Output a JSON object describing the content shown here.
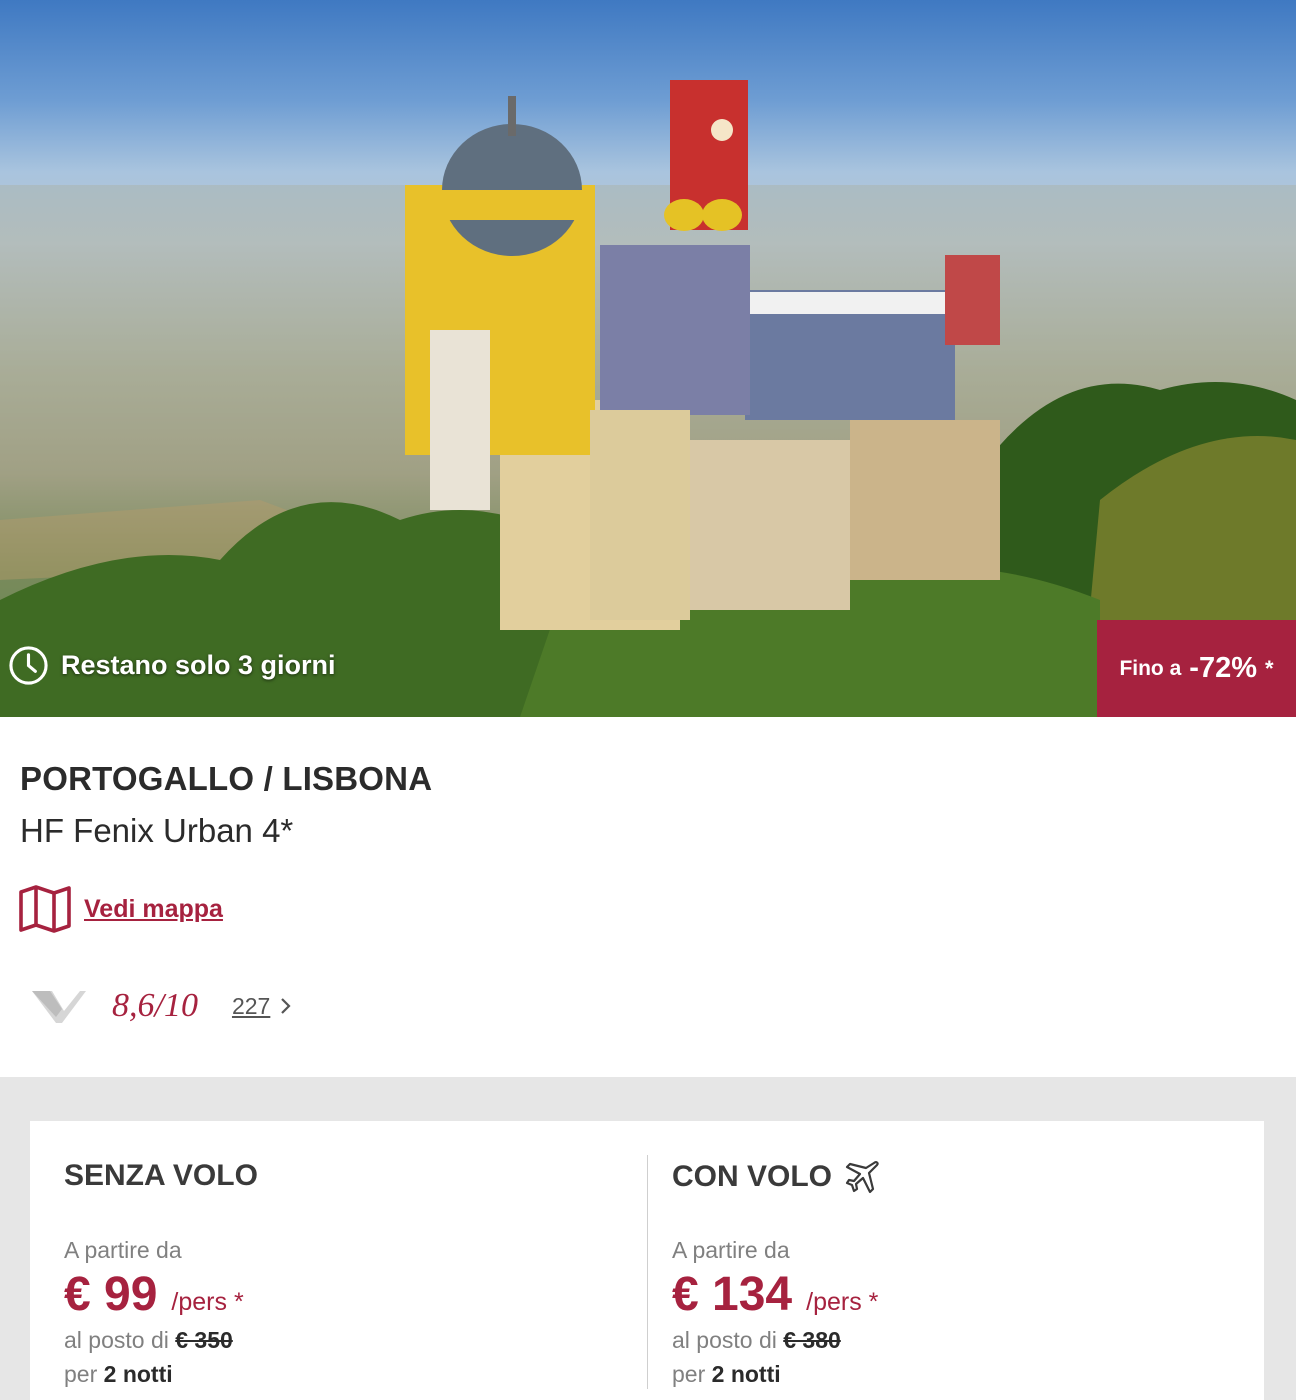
{
  "hero": {
    "image": "Pena Palace castle on a forested hill",
    "timer_icon": "clock-icon",
    "timer_text": "Restano solo 3 giorni",
    "discount": {
      "prefix": "Fino a",
      "value": "-72%",
      "asterisk": "*"
    }
  },
  "offer": {
    "location": "PORTOGALLO / LISBONA",
    "hotel": "HF Fenix Urban 4*",
    "map_icon": "map-icon",
    "map_link": "Vedi mappa",
    "rating": {
      "logo_icon": "voyage-privé-logo-icon",
      "score": "8,6/10",
      "reviews": "227",
      "chevron_icon": "chevron-right-icon"
    }
  },
  "pricing": {
    "without_flight": {
      "title": "SENZA VOLO",
      "from_label": "A partire da",
      "price": "€ 99",
      "per": "/pers *",
      "instead_label": "al posto di",
      "old_price": "€ 350",
      "per_label": "per",
      "nights": "2 notti"
    },
    "with_flight": {
      "title": "CON VOLO",
      "title_icon": "airplane-icon",
      "from_label": "A partire da",
      "price": "€ 134",
      "per": "/pers *",
      "instead_label": "al posto di",
      "old_price": "€ 380",
      "per_label": "per",
      "nights": "2 notti"
    }
  },
  "colors": {
    "brand": "#a6223f",
    "text": "#2b2b2b",
    "muted": "#808080",
    "panel_bg": "#e6e6e6"
  }
}
